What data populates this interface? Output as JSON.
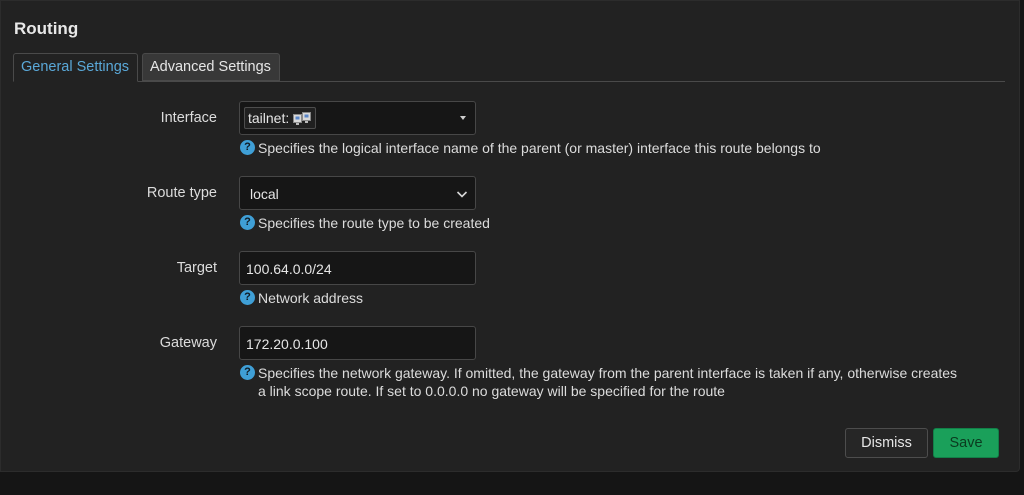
{
  "dialog": {
    "title": "Routing",
    "tabs": [
      {
        "label": "General Settings",
        "active": true
      },
      {
        "label": "Advanced Settings",
        "active": false
      }
    ]
  },
  "form": {
    "interface": {
      "label": "Interface",
      "value": "tailnet:",
      "icon": "network-interface-icon",
      "help": "Specifies the logical interface name of the parent (or master) interface this route belongs to"
    },
    "route_type": {
      "label": "Route type",
      "value": "local",
      "help": "Specifies the route type to be created"
    },
    "target": {
      "label": "Target",
      "value": "100.64.0.0/24",
      "help": "Network address"
    },
    "gateway": {
      "label": "Gateway",
      "value": "172.20.0.100",
      "help_line1": "Specifies the network gateway. If omitted, the gateway from the parent interface is taken if any, otherwise creates",
      "help_line2": "a link scope route. If set to 0.0.0.0 no gateway will be specified for the route"
    },
    "help_icon": "?"
  },
  "footer": {
    "dismiss_label": "Dismiss",
    "save_label": "Save"
  },
  "colors": {
    "accent": "#5aa8d8",
    "help_icon": "#3f9fd6",
    "save": "#1aa05a"
  }
}
